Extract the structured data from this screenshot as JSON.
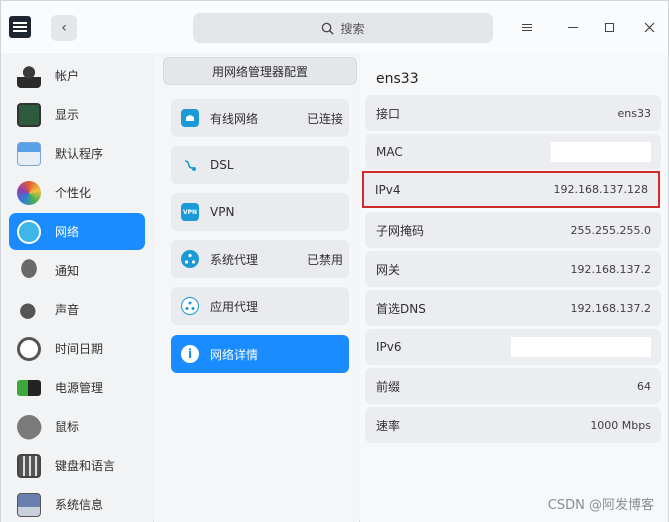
{
  "header": {
    "search_placeholder": "搜索"
  },
  "sidebar": {
    "items": [
      {
        "label": "帐户",
        "icon": "user-icon"
      },
      {
        "label": "显示",
        "icon": "monitor-icon"
      },
      {
        "label": "默认程序",
        "icon": "default-apps-icon"
      },
      {
        "label": "个性化",
        "icon": "palette-icon"
      },
      {
        "label": "网络",
        "icon": "network-icon"
      },
      {
        "label": "通知",
        "icon": "bell-icon"
      },
      {
        "label": "声音",
        "icon": "speaker-icon"
      },
      {
        "label": "时间日期",
        "icon": "clock-icon"
      },
      {
        "label": "电源管理",
        "icon": "battery-icon"
      },
      {
        "label": "鼠标",
        "icon": "mouse-icon"
      },
      {
        "label": "键盘和语言",
        "icon": "keyboard-icon"
      },
      {
        "label": "系统信息",
        "icon": "system-info-icon"
      }
    ]
  },
  "network_menu": {
    "header": "用网络管理器配置",
    "items": [
      {
        "label": "有线网络",
        "status": "已连接",
        "icon": "wired-network-icon"
      },
      {
        "label": "DSL",
        "status": "",
        "icon": "dsl-icon"
      },
      {
        "label": "VPN",
        "status": "",
        "icon": "vpn-icon"
      },
      {
        "label": "系统代理",
        "status": "已禁用",
        "icon": "system-proxy-icon"
      },
      {
        "label": "应用代理",
        "status": "",
        "icon": "app-proxy-icon"
      },
      {
        "label": "网络详情",
        "status": "",
        "icon": "info-icon"
      }
    ]
  },
  "details": {
    "title": "ens33",
    "rows": [
      {
        "key": "接口",
        "value": "ens33"
      },
      {
        "key": "MAC",
        "value": ""
      },
      {
        "key": "IPv4",
        "value": "192.168.137.128"
      },
      {
        "key": "子网掩码",
        "value": "255.255.255.0"
      },
      {
        "key": "网关",
        "value": "192.168.137.2"
      },
      {
        "key": "首选DNS",
        "value": "192.168.137.2"
      },
      {
        "key": "IPv6",
        "value": ""
      },
      {
        "key": "前缀",
        "value": "64"
      },
      {
        "key": "速率",
        "value": "1000 Mbps"
      }
    ]
  },
  "watermark": "CSDN @阿发博客",
  "colors": {
    "accent": "#1a8cff",
    "highlight_border": "#d22b2b"
  }
}
